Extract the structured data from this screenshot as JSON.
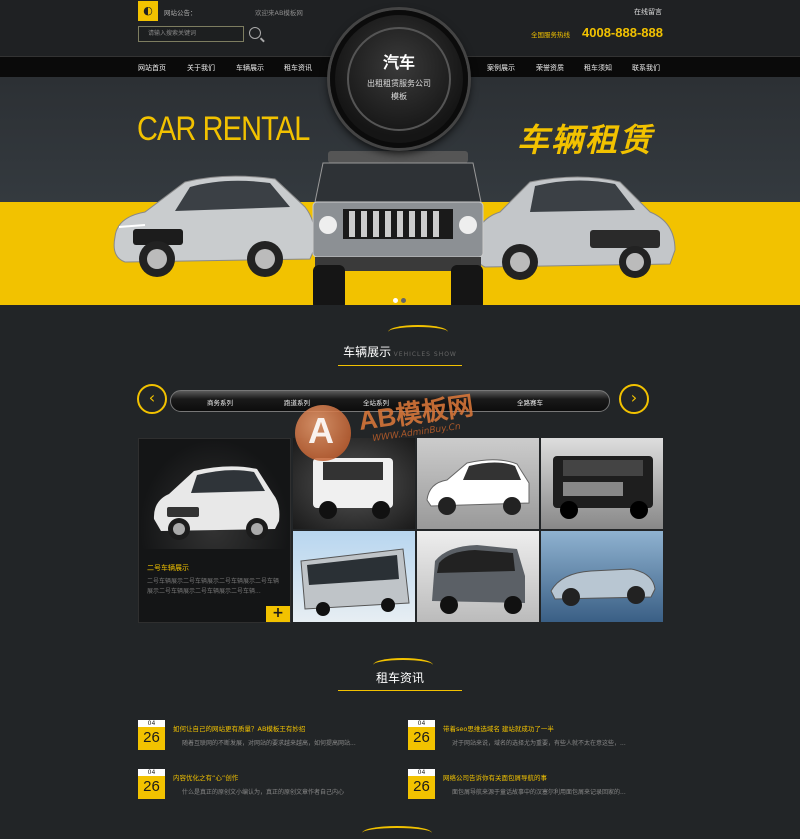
{
  "topbar": {
    "notice_label": "网站公告：",
    "notice_text": "欢迎来AB模板网",
    "search_placeholder": "请输入搜索关键词",
    "online_link": "在线留言",
    "hotline_label": "全国服务热线",
    "hotline_number": "4008-888-888"
  },
  "logo": {
    "title": "汽车",
    "subtitle": "出租租赁服务公司模板"
  },
  "nav": {
    "left": [
      "网站首页",
      "关于我们",
      "车辆展示",
      "租车资讯"
    ],
    "right": [
      "案例展示",
      "荣誉资质",
      "租车须知",
      "联系我们"
    ]
  },
  "banner": {
    "en_title": "CAR RENTAL",
    "cn_title": "车辆租赁",
    "slides": 2,
    "active_slide": 0
  },
  "showcase": {
    "title": "车辆展示",
    "subtitle": "VEHICLES SHOW",
    "tabs": [
      "商务系列",
      "跑道系列",
      "全站系列",
      "全路赛车"
    ],
    "feature": {
      "title": "二号车辆展示",
      "desc": "二号车辆展示二号车辆展示二号车辆展示二号车辆展示二号车辆展示二号车辆展示二号车辆..."
    }
  },
  "watermark": {
    "brand": "AB模板网",
    "url": "WWW.AdminBuy.Cn"
  },
  "news": {
    "title": "租车资讯",
    "items": [
      {
        "month": "04",
        "day": "26",
        "title": "如何让自己的网站更有质量？AB模板王有妙招",
        "desc": "随着互联网的不断发展，对网站的要求越来越高，如何提高网站..."
      },
      {
        "month": "04",
        "day": "26",
        "title": "带着seo思维选域名 建站就成功了一半",
        "desc": "对于网站来说，域名的选择尤为重要，有些人就不太在意这些，..."
      },
      {
        "month": "04",
        "day": "26",
        "title": "内容优化之有“心”创作",
        "desc": "什么是真正的原创文小编认为，真正的原创文章作者自己内心"
      },
      {
        "month": "04",
        "day": "26",
        "title": "网络公司告诉你有关面包屑导航的事",
        "desc": "面包屑导航来源于童话故事中的汉塞尔利用面包屑来记录回家的..."
      }
    ]
  },
  "colors": {
    "accent": "#f2c200",
    "background": "#222527",
    "nav_bg": "#0a0a0a"
  }
}
